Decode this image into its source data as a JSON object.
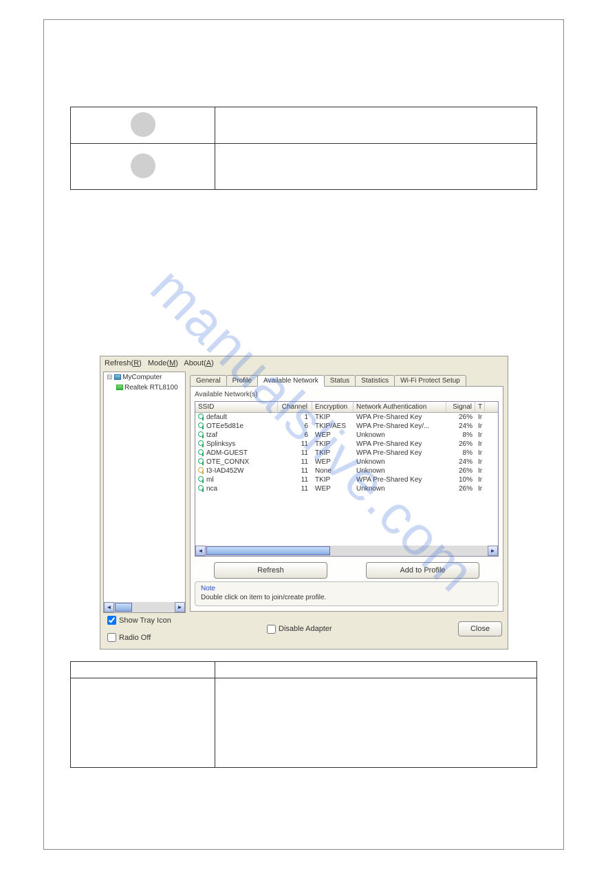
{
  "watermark": "manualslive.com",
  "menubar": {
    "refresh": "Refresh(R)",
    "mode": "Mode(M)",
    "about": "About(A)"
  },
  "tree": {
    "root": "MyComputer",
    "adapter": "Realtek RTL8100"
  },
  "tabs": {
    "general": "General",
    "profile": "Profile",
    "available": "Available Network",
    "status": "Status",
    "statistics": "Statistics",
    "wps": "Wi-Fi Protect Setup"
  },
  "groupLabel": "Available Network(s)",
  "columns": {
    "ssid": "SSID",
    "channel": "Channel",
    "encryption": "Encryption",
    "auth": "Network Authentication",
    "signal": "Signal"
  },
  "networks": [
    {
      "ssid": "default",
      "ch": "1",
      "enc": "TKIP",
      "auth": "WPA Pre-Shared Key",
      "sig": "26%",
      "last": "Ir"
    },
    {
      "ssid": "OTEe5d81e",
      "ch": "6",
      "enc": "TKIP/AES",
      "auth": "WPA Pre-Shared Key/...",
      "sig": "24%",
      "last": "Ir"
    },
    {
      "ssid": "tzaf",
      "ch": "6",
      "enc": "WEP",
      "auth": "Unknown",
      "sig": "8%",
      "last": "Ir"
    },
    {
      "ssid": "Splinksys",
      "ch": "11",
      "enc": "TKIP",
      "auth": "WPA Pre-Shared Key",
      "sig": "26%",
      "last": "Ir"
    },
    {
      "ssid": "ADM-GUEST",
      "ch": "11",
      "enc": "TKIP",
      "auth": "WPA Pre-Shared Key",
      "sig": "8%",
      "last": "Ir"
    },
    {
      "ssid": "OTE_CONNX",
      "ch": "11",
      "enc": "WEP",
      "auth": "Unknown",
      "sig": "24%",
      "last": "Ir"
    },
    {
      "ssid": "I3-IAD452W",
      "ch": "11",
      "enc": "None",
      "auth": "Unknown",
      "sig": "26%",
      "last": "Ir",
      "yellow": true
    },
    {
      "ssid": "ml",
      "ch": "11",
      "enc": "TKIP",
      "auth": "WPA Pre-Shared Key",
      "sig": "10%",
      "last": "Ir"
    },
    {
      "ssid": "nca",
      "ch": "11",
      "enc": "WEP",
      "auth": "Unknown",
      "sig": "26%",
      "last": "Ir"
    }
  ],
  "buttons": {
    "refresh": "Refresh",
    "addProfile": "Add to Profile",
    "close": "Close"
  },
  "note": {
    "label": "Note",
    "text": "Double click on item to join/create profile."
  },
  "checkboxes": {
    "showTray": "Show Tray Icon",
    "radioOff": "Radio Off",
    "disableAdapter": "Disable Adapter"
  }
}
